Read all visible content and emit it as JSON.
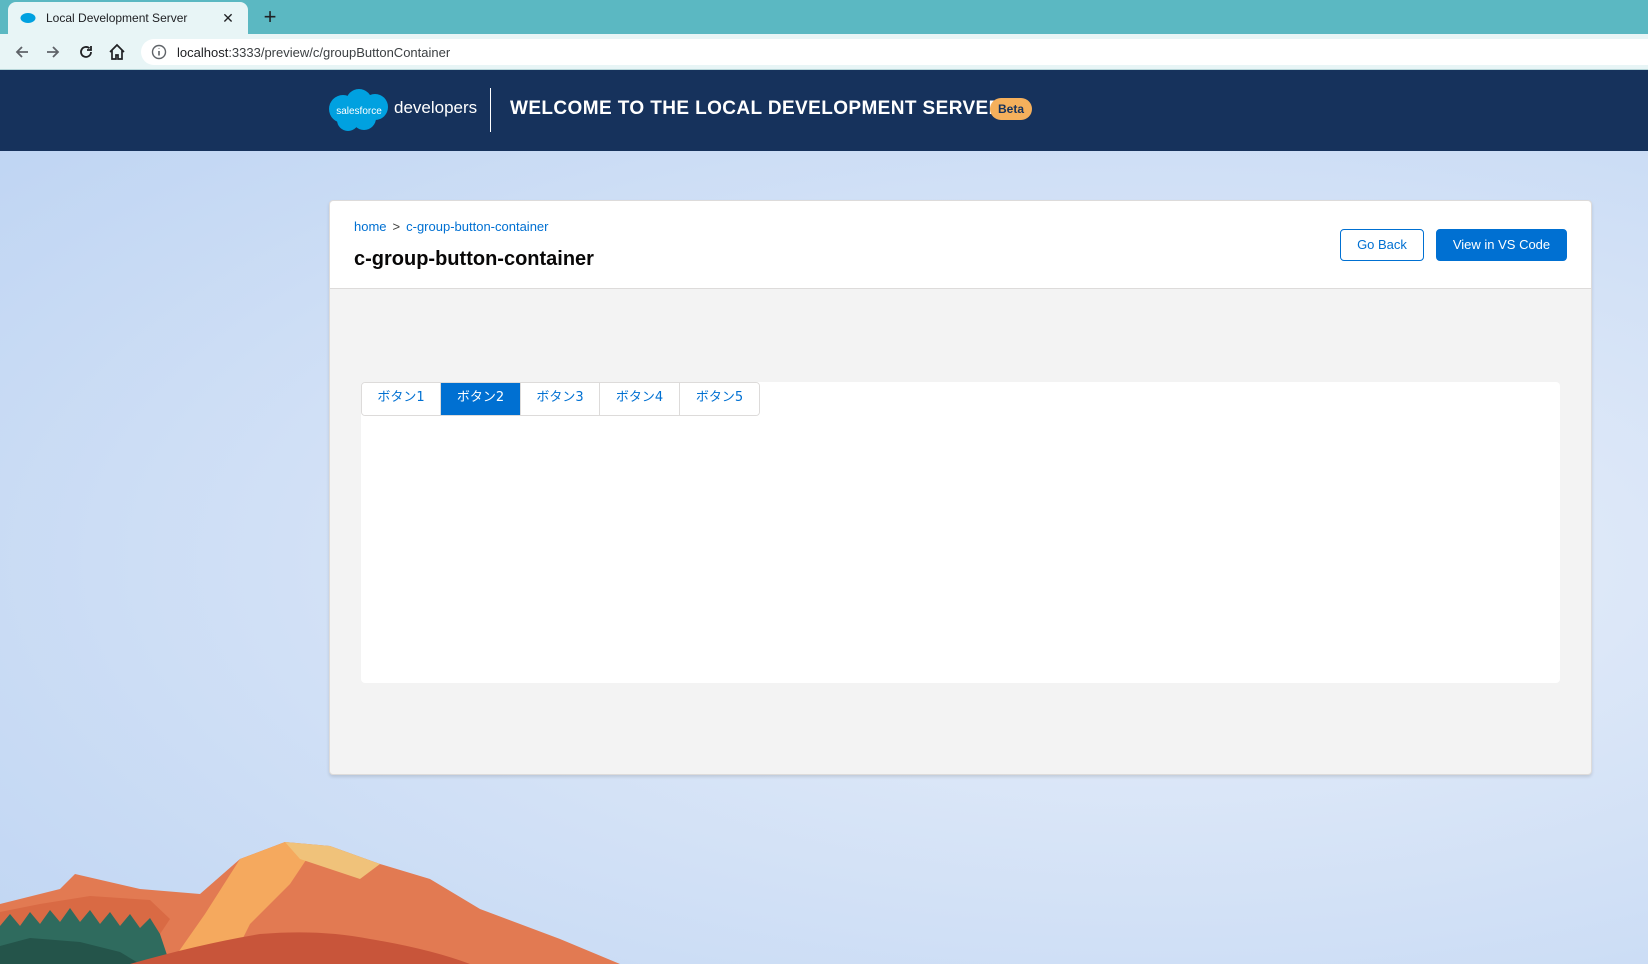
{
  "browser": {
    "tab_title": "Local Development Server",
    "tab_close": "✕",
    "new_tab": "+",
    "url_host": "localhost",
    "url_rest": ":3333/preview/c/groupButtonContainer"
  },
  "header": {
    "logo_text": "salesforce",
    "logo_suffix": "developers",
    "welcome": "Welcome to the Local Development Server",
    "badge": "Beta"
  },
  "card": {
    "breadcrumb_home": "home",
    "breadcrumb_sep": ">",
    "breadcrumb_current": "c-group-button-container",
    "title": "c-group-button-container",
    "go_back": "Go Back",
    "view_vscode": "View in VS Code"
  },
  "button_group": {
    "buttons": [
      "ボタン1",
      "ボタン2",
      "ボタン3",
      "ボタン4",
      "ボタン5"
    ],
    "selected": "ボタン2"
  },
  "colors": {
    "header_bg": "#16325c",
    "brand_blue": "#0070d2",
    "beta_badge": "#f5b05c",
    "browser_chrome": "#5bb8c2"
  }
}
